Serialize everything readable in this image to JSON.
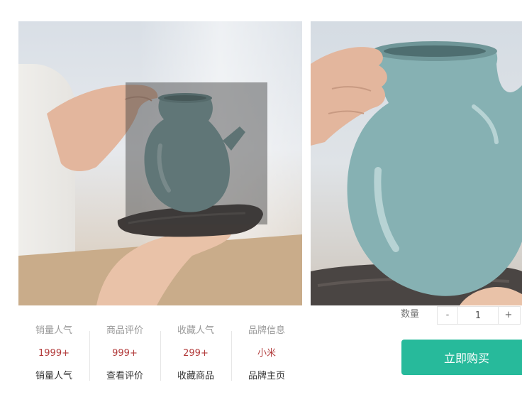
{
  "gallery": {
    "main_image": {
      "description_icon": "celadon-teapot-photo"
    },
    "zoom_image": {
      "description_icon": "celadon-teapot-zoom-photo"
    }
  },
  "stats": [
    {
      "title": "销量人气",
      "value": "1999+",
      "link": "销量人气"
    },
    {
      "title": "商品评价",
      "value": "999+",
      "link": "查看评价"
    },
    {
      "title": "收藏人气",
      "value": "299+",
      "link": "收藏商品"
    },
    {
      "title": "品牌信息",
      "value": "小米",
      "link": "品牌主页"
    }
  ],
  "quantity": {
    "label": "数量",
    "minus": "-",
    "value": "1",
    "plus": "+"
  },
  "buy": {
    "label": "立即购买"
  },
  "colors": {
    "accent": "#27ba9b",
    "price": "#b23b3b",
    "lens": "#3c3c3c"
  }
}
